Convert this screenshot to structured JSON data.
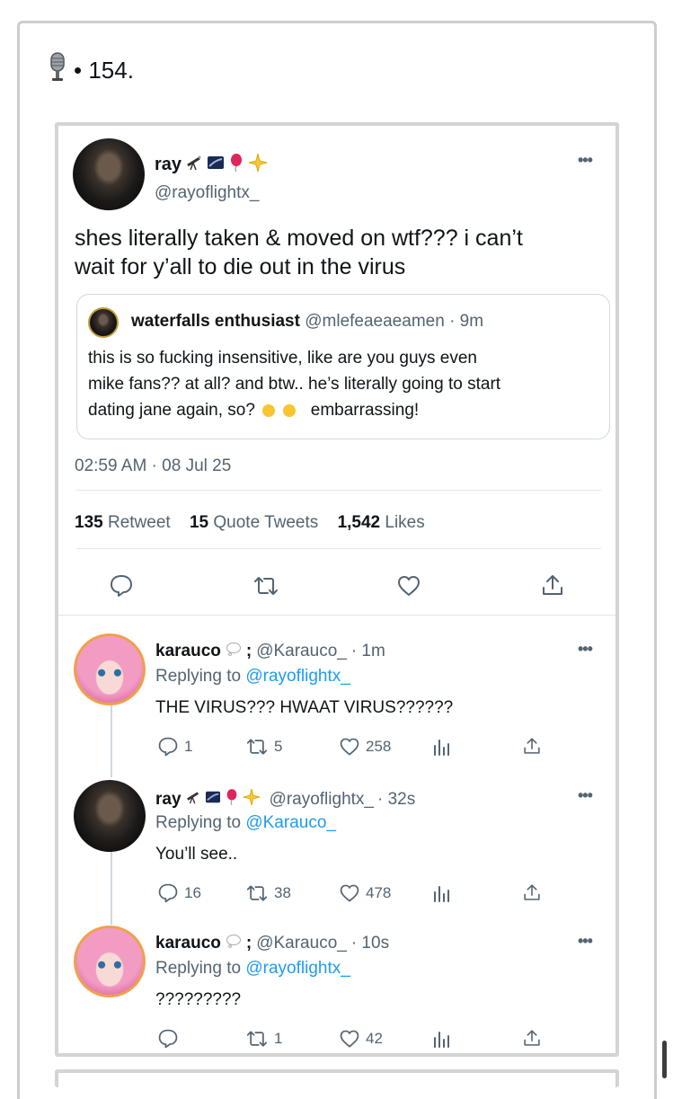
{
  "post": {
    "icon": "microphone-icon",
    "title": "• 154."
  },
  "main_tweet": {
    "display_name": "ray",
    "name_emoji_icons": [
      "telescope-icon",
      "milky-way-icon",
      "balloon-icon",
      "sparkle-icon"
    ],
    "handle": "@rayoflightx_",
    "text_line1": "shes literally taken & moved on wtf??? i can’t",
    "text_line2": "wait for y’all to die out in the virus",
    "quote": {
      "display_name": "waterfalls enthusiast",
      "handle": "@mlefeaeaeamen",
      "time": "· 9m",
      "line1": "this is so fucking insensitive, like are you guys even",
      "line2": "mike fans?? at all? and btw.. he’s literally going to start",
      "line3": "dating jane again, so?",
      "line3_end": "embarrassing!",
      "emoji_icons": [
        "laughing-crying-emoji-icon",
        "laughing-crying-emoji-icon"
      ]
    },
    "timestamp": "02:59 AM · 08 Jul 25",
    "stats": {
      "retweets": "135",
      "retweets_label": "Retweet",
      "quotes": "15",
      "quotes_label": "Quote Tweets",
      "likes": "1,542",
      "likes_label": "Likes"
    }
  },
  "replies": [
    {
      "display_name": "karauco",
      "name_suffix": ";",
      "handle": "@Karauco_",
      "time": "· 1m",
      "replying_prefix": "Replying to",
      "replying_to": "@rayoflightx_",
      "text": "THE VIRUS??? HWAAT VIRUS??????",
      "replies": "1",
      "retweets": "5",
      "likes": "258"
    },
    {
      "display_name": "ray",
      "handle": "@rayoflightx_",
      "time": "· 32s",
      "replying_prefix": "Replying to",
      "replying_to": "@Karauco_",
      "text": "You’ll see..",
      "replies": "16",
      "retweets": "38",
      "likes": "478"
    },
    {
      "display_name": "karauco",
      "name_suffix": ";",
      "handle": "@Karauco_",
      "time": "· 10s",
      "replying_prefix": "Replying to",
      "replying_to": "@rayoflightx_",
      "text": "?????????",
      "replies": "",
      "retweets": "1",
      "likes": "42"
    }
  ],
  "colors": {
    "link": "#1d9bf0",
    "muted": "#536471",
    "text": "#0f1419",
    "border": "#d4d4d4"
  }
}
